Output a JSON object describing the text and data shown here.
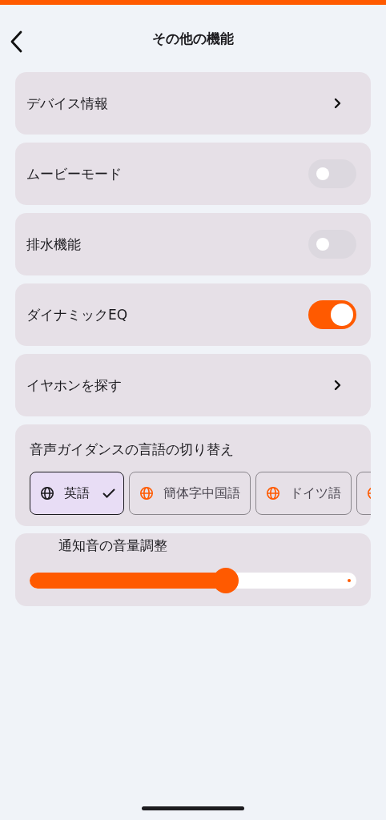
{
  "header": {
    "title": "その他の機能"
  },
  "rows": [
    {
      "kind": "link",
      "label": "デバイス情報"
    },
    {
      "kind": "toggle",
      "label": "ムービーモード",
      "on": false
    },
    {
      "kind": "toggle",
      "label": "排水機能",
      "on": false
    },
    {
      "kind": "toggle",
      "label": "ダイナミックEQ",
      "on": true
    },
    {
      "kind": "link",
      "label": "イヤホンを探す"
    }
  ],
  "voice_language": {
    "title": "音声ガイダンスの言語の切り替え",
    "options": [
      {
        "label": "英語",
        "selected": true
      },
      {
        "label": "簡体字中国語",
        "selected": false
      },
      {
        "label": "ドイツ語",
        "selected": false
      },
      {
        "selected": false
      }
    ]
  },
  "notification_volume": {
    "title": "通知音の音量調整",
    "level": 0.6
  }
}
